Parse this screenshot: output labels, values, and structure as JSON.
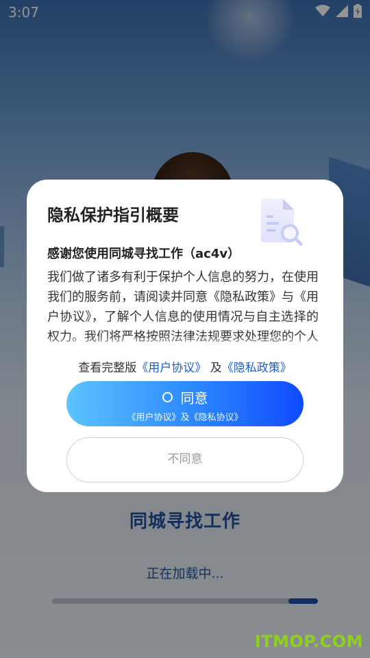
{
  "status_bar": {
    "time": "3:07",
    "icons": [
      "wifi-icon",
      "cellular-signal-icon",
      "battery-icon"
    ]
  },
  "splash": {
    "app_name": "同城寻找工作",
    "loading_text": "正在加载中...",
    "progress_fraction": 0.11,
    "watermark": "ITMOP.COM"
  },
  "dialog": {
    "title": "隐私保护指引概要",
    "icon": "document-search-icon",
    "subtitle": "感谢您使用同城寻找工作（ac4v）",
    "body": "我们做了诸多有利于保护个人信息的努力，在使用我们的服务前，请阅读并同意《隐私政策》与《用户协议》，了解个人信息的使用情况与自主选择的权力。我们将严格按照法律法规要求处理您的个人信息。",
    "links_prefix": "查看完整版",
    "user_agreement_link": "《用户协议》",
    "links_and": "及",
    "privacy_policy_link": "《隐私政策》",
    "agree_label": "同意",
    "agree_sublabel": "《用户协议》及《隐私协议》",
    "disagree_label": "不同意"
  },
  "colors": {
    "accent_blue": "#1a5fd6",
    "button_gradient_start": "#5cc5ff",
    "button_gradient_end": "#0f4bff",
    "watermark_green": "#8fd11a"
  }
}
